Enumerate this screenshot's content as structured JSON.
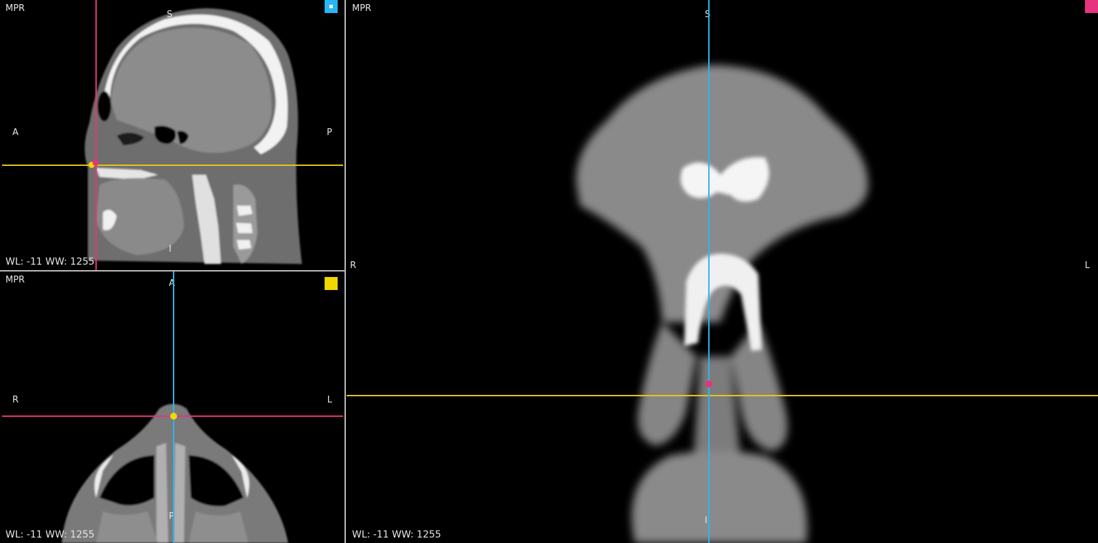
{
  "viewports": {
    "sagittal": {
      "label": "MPR",
      "window": "WL: -11 WW: 1255",
      "orient": {
        "top": "S",
        "left": "A",
        "right": "P",
        "bottom": "I"
      },
      "marker_color": "#29b6f6",
      "crosshair_h_color": "#e6c619",
      "crosshair_v_color": "#e8337f"
    },
    "axial": {
      "label": "MPR",
      "window": "WL: -11 WW: 1255",
      "orient": {
        "top": "A",
        "left": "R",
        "right": "L",
        "bottom": "P"
      },
      "marker_color": "#f2d600",
      "crosshair_h_color": "#e8337f",
      "crosshair_v_color": "#29b6f6"
    },
    "coronal": {
      "label": "MPR",
      "window": "WL: -11 WW: 1255",
      "orient": {
        "top": "S",
        "left": "R",
        "right": "L",
        "bottom": "I"
      },
      "marker_color": "#e8337f",
      "crosshair_h_color": "#e6c619",
      "crosshair_v_color": "#29b6f6"
    }
  }
}
